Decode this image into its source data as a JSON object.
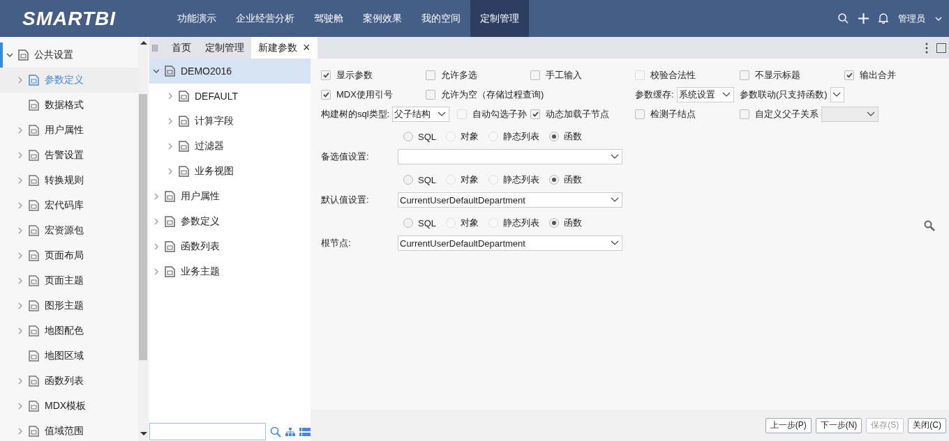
{
  "header": {
    "logo": "SMARTBI",
    "nav": [
      {
        "label": "功能演示",
        "selected": false
      },
      {
        "label": "企业经营分析",
        "selected": false
      },
      {
        "label": "驾驶舱",
        "selected": false
      },
      {
        "label": "案例效果",
        "selected": false
      },
      {
        "label": "我的空间",
        "selected": false
      },
      {
        "label": "定制管理",
        "selected": true
      }
    ],
    "user": "管理员"
  },
  "sidebar": {
    "items": [
      {
        "label": "公共设置",
        "expanded": true,
        "children": [
          {
            "label": "参数定义",
            "expandable": true,
            "selected": true
          },
          {
            "label": "数据格式",
            "expandable": false,
            "selected": false
          },
          {
            "label": "用户属性",
            "expandable": true,
            "selected": false
          },
          {
            "label": "告警设置",
            "expandable": true,
            "selected": false
          },
          {
            "label": "转换规则",
            "expandable": true,
            "selected": false
          },
          {
            "label": "宏代码库",
            "expandable": true,
            "selected": false
          },
          {
            "label": "宏资源包",
            "expandable": true,
            "selected": false
          },
          {
            "label": "页面布局",
            "expandable": true,
            "selected": false
          },
          {
            "label": "页面主题",
            "expandable": true,
            "selected": false
          },
          {
            "label": "图形主题",
            "expandable": true,
            "selected": false
          },
          {
            "label": "地图配色",
            "expandable": true,
            "selected": false
          },
          {
            "label": "地图区域",
            "expandable": false,
            "selected": false
          },
          {
            "label": "函数列表",
            "expandable": true,
            "selected": false
          },
          {
            "label": "MDX模板",
            "expandable": true,
            "selected": false
          },
          {
            "label": "值域范围",
            "expandable": true,
            "selected": false
          }
        ]
      }
    ]
  },
  "tabs": [
    {
      "label": "首页",
      "selected": false
    },
    {
      "label": "定制管理",
      "selected": false
    },
    {
      "label": "新建参数",
      "selected": true,
      "close": "×"
    }
  ],
  "tree": {
    "items": [
      {
        "label": "DEMO2016",
        "expanded": true,
        "selected": true,
        "children": [
          {
            "label": "DEFAULT",
            "expanded": false,
            "selected": false
          },
          {
            "label": "计算字段",
            "expanded": false,
            "selected": false
          },
          {
            "label": "过滤器",
            "expanded": false,
            "selected": false
          },
          {
            "label": "业务视图",
            "expanded": false,
            "selected": false
          }
        ]
      },
      {
        "label": "用户属性",
        "expanded": false,
        "selected": false
      },
      {
        "label": "参数定义",
        "expanded": false,
        "selected": false
      },
      {
        "label": "函数列表",
        "expanded": false,
        "selected": false
      },
      {
        "label": "业务主题",
        "expanded": false,
        "selected": false
      }
    ]
  },
  "form": {
    "rows": [
      [
        {
          "kind": "checkbox",
          "label": "显示参数",
          "checked": true,
          "disabled": false
        },
        {
          "kind": "checkbox",
          "label": "允许多选",
          "checked": false,
          "disabled": false
        },
        {
          "kind": "checkbox",
          "label": "手工输入",
          "checked": false,
          "disabled": false
        },
        {
          "kind": "checkbox",
          "label": "校验合法性",
          "checked": false,
          "disabled": true
        },
        {
          "kind": "checkbox",
          "label": "不显示标题",
          "checked": false,
          "disabled": false
        },
        {
          "kind": "checkbox",
          "label": "输出合并",
          "checked": true,
          "disabled": false
        }
      ],
      [
        {
          "kind": "checkbox",
          "label": "MDX使用引号",
          "checked": true,
          "disabled": false
        },
        {
          "kind": "checkbox",
          "label": "允许为空（存储过程查询)",
          "checked": false,
          "disabled": false
        },
        "",
        {
          "kind": "select",
          "label": "参数缓存:",
          "value": "系统设置",
          "disabled": false
        },
        {
          "kind": "select",
          "label": "参数联动(只支持函数)",
          "disabled": false
        }
      ],
      [
        {
          "kind": "select",
          "label": "构建树的sql类型:",
          "value": "父子结构",
          "disabled": false
        },
        {
          "kind": "checkbox",
          "label": "自动勾选子孙",
          "checked": false,
          "disabled": true
        },
        {
          "kind": "checkbox",
          "label": "动态加载子节点",
          "checked": true,
          "disabled": false
        },
        {
          "kind": "checkbox",
          "label": "检测子结点",
          "checked": false,
          "disabled": false
        },
        {
          "kind": "checkbox_select",
          "label": "自定义父子关系",
          "checked": false,
          "disabled": false,
          "select_disabled": true
        }
      ]
    ],
    "sections": [
      {
        "label": "备选值设置:",
        "sources": [
          {
            "label": "SQL",
            "selected": false,
            "disabled": false
          },
          {
            "label": "对象",
            "selected": false,
            "disabled": true
          },
          {
            "label": "静态列表",
            "selected": false,
            "disabled": true
          },
          {
            "label": "函数",
            "selected": true,
            "disabled": false
          }
        ]
      },
      {
        "label": "默认值设置:",
        "value": "CurrentUserDefaultDepartment",
        "sources": [
          {
            "label": "SQL",
            "selected": false,
            "disabled": false
          },
          {
            "label": "对象",
            "selected": false,
            "disabled": true
          },
          {
            "label": "静态列表",
            "selected": false,
            "disabled": true
          },
          {
            "label": "函数",
            "selected": true,
            "disabled": false
          }
        ]
      },
      {
        "label": "根节点:",
        "value": "CurrentUserDefaultDepartment",
        "sources": [
          {
            "label": "SQL",
            "selected": false,
            "disabled": false
          },
          {
            "label": "对象",
            "selected": false,
            "disabled": true
          },
          {
            "label": "静态列表",
            "selected": false,
            "disabled": true
          },
          {
            "label": "函数",
            "selected": true,
            "disabled": false
          }
        ]
      }
    ]
  },
  "buttons": [
    {
      "label": "上一步(P)",
      "disabled": false
    },
    {
      "label": "下一步(N)",
      "disabled": false
    },
    {
      "label": "保存(S)",
      "disabled": true
    },
    {
      "label": "关闭(C)",
      "disabled": false
    }
  ]
}
